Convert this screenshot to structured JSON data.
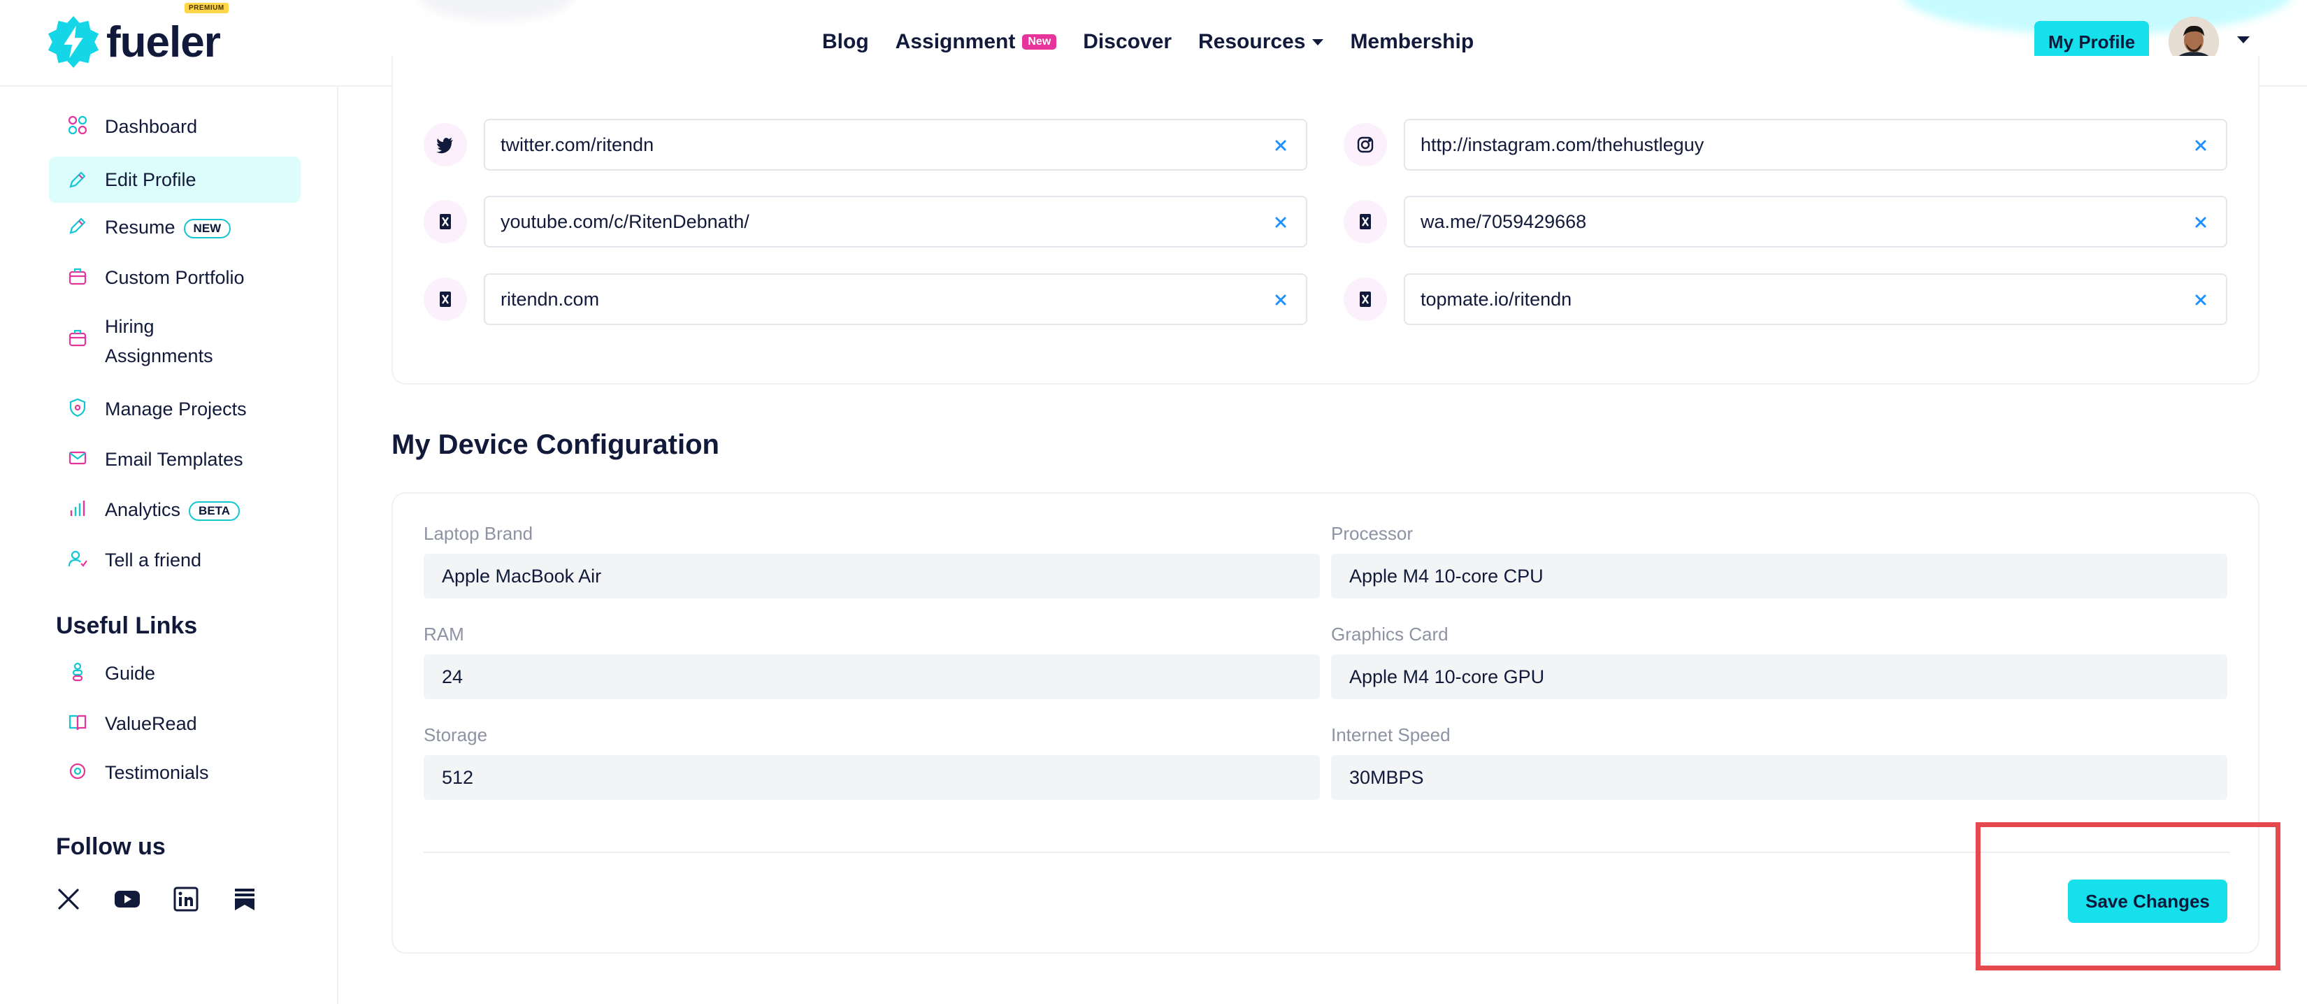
{
  "header": {
    "logo_text": "fueler",
    "premium_badge": "PREMIUM",
    "nav": [
      {
        "label": "Blog"
      },
      {
        "label": "Assignment",
        "badge": "New"
      },
      {
        "label": "Discover"
      },
      {
        "label": "Resources"
      },
      {
        "label": "Membership"
      }
    ],
    "my_profile_label": "My Profile"
  },
  "sidebar": {
    "items": [
      {
        "label": "Dashboard",
        "icon": "grid-icon"
      },
      {
        "label": "Edit Profile",
        "icon": "pencil-icon",
        "active": true
      },
      {
        "label": "Resume",
        "icon": "pencil-icon",
        "badge": "NEW"
      },
      {
        "label": "Custom Portfolio",
        "icon": "briefcase-icon"
      },
      {
        "label": "Hiring Assignments",
        "icon": "briefcase-icon"
      },
      {
        "label": "Manage Projects",
        "icon": "shield-icon"
      },
      {
        "label": "Email Templates",
        "icon": "mail-icon"
      },
      {
        "label": "Analytics",
        "icon": "bar-chart-icon",
        "badge": "BETA"
      },
      {
        "label": "Tell a friend",
        "icon": "user-add-icon"
      }
    ],
    "useful_links_title": "Useful Links",
    "useful_links": [
      {
        "label": "Guide",
        "icon": "guide-icon"
      },
      {
        "label": "ValueRead",
        "icon": "book-icon"
      },
      {
        "label": "Testimonials",
        "icon": "chat-icon"
      }
    ],
    "follow_title": "Follow us",
    "social": [
      "x-icon",
      "youtube-icon",
      "linkedin-icon",
      "substack-icon"
    ]
  },
  "social_links": [
    {
      "value": "twitter.com/ritendn",
      "icon": "twitter-icon"
    },
    {
      "value": "http://instagram.com/thehustleguy",
      "icon": "instagram-icon"
    },
    {
      "value": "youtube.com/c/RitenDebnath/",
      "icon": "link-icon"
    },
    {
      "value": "wa.me/7059429668",
      "icon": "link-icon"
    },
    {
      "value": "ritendn.com",
      "icon": "link-icon"
    },
    {
      "value": "topmate.io/ritendn",
      "icon": "link-icon"
    }
  ],
  "device_config": {
    "title": "My Device Configuration",
    "fields": [
      {
        "label": "Laptop Brand",
        "value": "Apple MacBook Air"
      },
      {
        "label": "Processor",
        "value": "Apple M4 10-core CPU"
      },
      {
        "label": "RAM",
        "value": "24"
      },
      {
        "label": "Graphics Card",
        "value": "Apple M4 10-core GPU"
      },
      {
        "label": "Storage",
        "value": "512"
      },
      {
        "label": "Internet Speed",
        "value": "30MBPS"
      }
    ],
    "save_label": "Save Changes"
  },
  "colors": {
    "accent": "#15e0ec",
    "active_bg": "#ddfdfd",
    "badge_new": "#e6349b",
    "highlight": "#e5484d"
  }
}
